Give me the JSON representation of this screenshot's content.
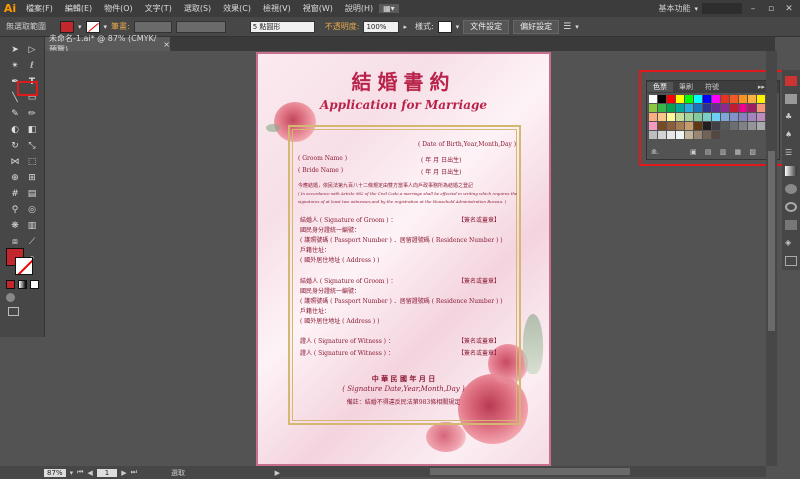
{
  "app": {
    "logo": "Ai",
    "menus": [
      "檔案(F)",
      "編輯(E)",
      "物件(O)",
      "文字(T)",
      "選取(S)",
      "效果(C)",
      "檢視(V)",
      "視窗(W)",
      "說明(H)"
    ],
    "workspace": "基本功能",
    "search_icon": "search-icon"
  },
  "control_bar": {
    "selection_label": "無選取範圍",
    "stroke_label": "筆畫:",
    "brush_label": "5 點圓形",
    "opacity_label": "不透明度:",
    "opacity_value": "100%",
    "style_label": "樣式:",
    "doc_setup": "文件設定",
    "prefs": "偏好設定",
    "accent_color": "#e8a84c"
  },
  "document_tab": {
    "title": "未命名-1.ai* @ 87% (CMYK/預覽)",
    "close": "×"
  },
  "artboard": {
    "title_zh": "結婚書約",
    "title_en": "Application for Marriage",
    "date_of_birth": "( Date of Birth,Year,Month,Day )",
    "groom_name": "( Groom Name )",
    "bride_name": "( Bride Name )",
    "ymd_born": "(      年      月      日出生)",
    "law_zh": "今應結婚，依民法第九百八十二條規定由雙方當事人向戶政事務所為結婚之登記",
    "law_en_1": "( In accordance with Article 982 of the Civil Code,a marriage shall be effected in writing which requires the",
    "law_en_2": "signatures of at least two witnesses,and by the registration at the Household Administration Bureau. )",
    "groom_sig": "結婚人 ( Signature of Groom )   ：",
    "sign_seal": "【簽名或蓋章】",
    "id_label": "國民身分證統一編號：",
    "passport": "( 護照號碼 ( Passport Number ) ．居留證號碼 ( Residence Number ) )",
    "household": "戶籍住址：",
    "overseas": "( 國外居住地址 ( Address ) )",
    "witness": "證人 ( Signature of Witness )   ：",
    "roc_date": "中 華 民 國     年  月  日",
    "sig_date": "( Signature Date,Year,Month,Day )",
    "note": "備註：結婚不得違反民法第983條相關規定"
  },
  "swatches_panel": {
    "tabs": [
      "色票",
      "筆刷",
      "符號"
    ],
    "colors": [
      "#ffffff",
      "#000000",
      "#ff0000",
      "#ffff00",
      "#00ff00",
      "#00ffff",
      "#0000ff",
      "#ff00ff",
      "#e8311e",
      "#f05a28",
      "#f7941d",
      "#fbb040",
      "#fff200",
      "#8dc63f",
      "#39b54a",
      "#00a651",
      "#00a79d",
      "#27aae1",
      "#1c75bc",
      "#2e3192",
      "#662d91",
      "#92278f",
      "#be1e2d",
      "#ec008c",
      "#9e1f63",
      "#f69679",
      "#f9ad81",
      "#fdc689",
      "#fff799",
      "#c4df9b",
      "#a3d39c",
      "#82ca9d",
      "#7accc8",
      "#6dcff6",
      "#7da7d9",
      "#8393ca",
      "#8781bd",
      "#a186be",
      "#bd8cbf",
      "#f49ac1",
      "#754c24",
      "#8b5e3c",
      "#a67c52",
      "#c69c6d",
      "#603913",
      "#231f20",
      "#414042",
      "#58595b",
      "#6d6e71",
      "#808285",
      "#939598",
      "#a7a9ac",
      "#bcbec0",
      "#d1d3d4",
      "#e6e7e8",
      "#f1f2f2",
      "#c2b59b",
      "#998675",
      "#736357",
      "#534741"
    ],
    "highlight_color": "#e01a1a"
  },
  "status_bar": {
    "zoom": "87%",
    "page": "1",
    "mode": "選取"
  },
  "fill_color": "#c1272d",
  "artboard_border": "#c86f8f",
  "title_color": "#b9234b",
  "frame_color": "#d4b770"
}
